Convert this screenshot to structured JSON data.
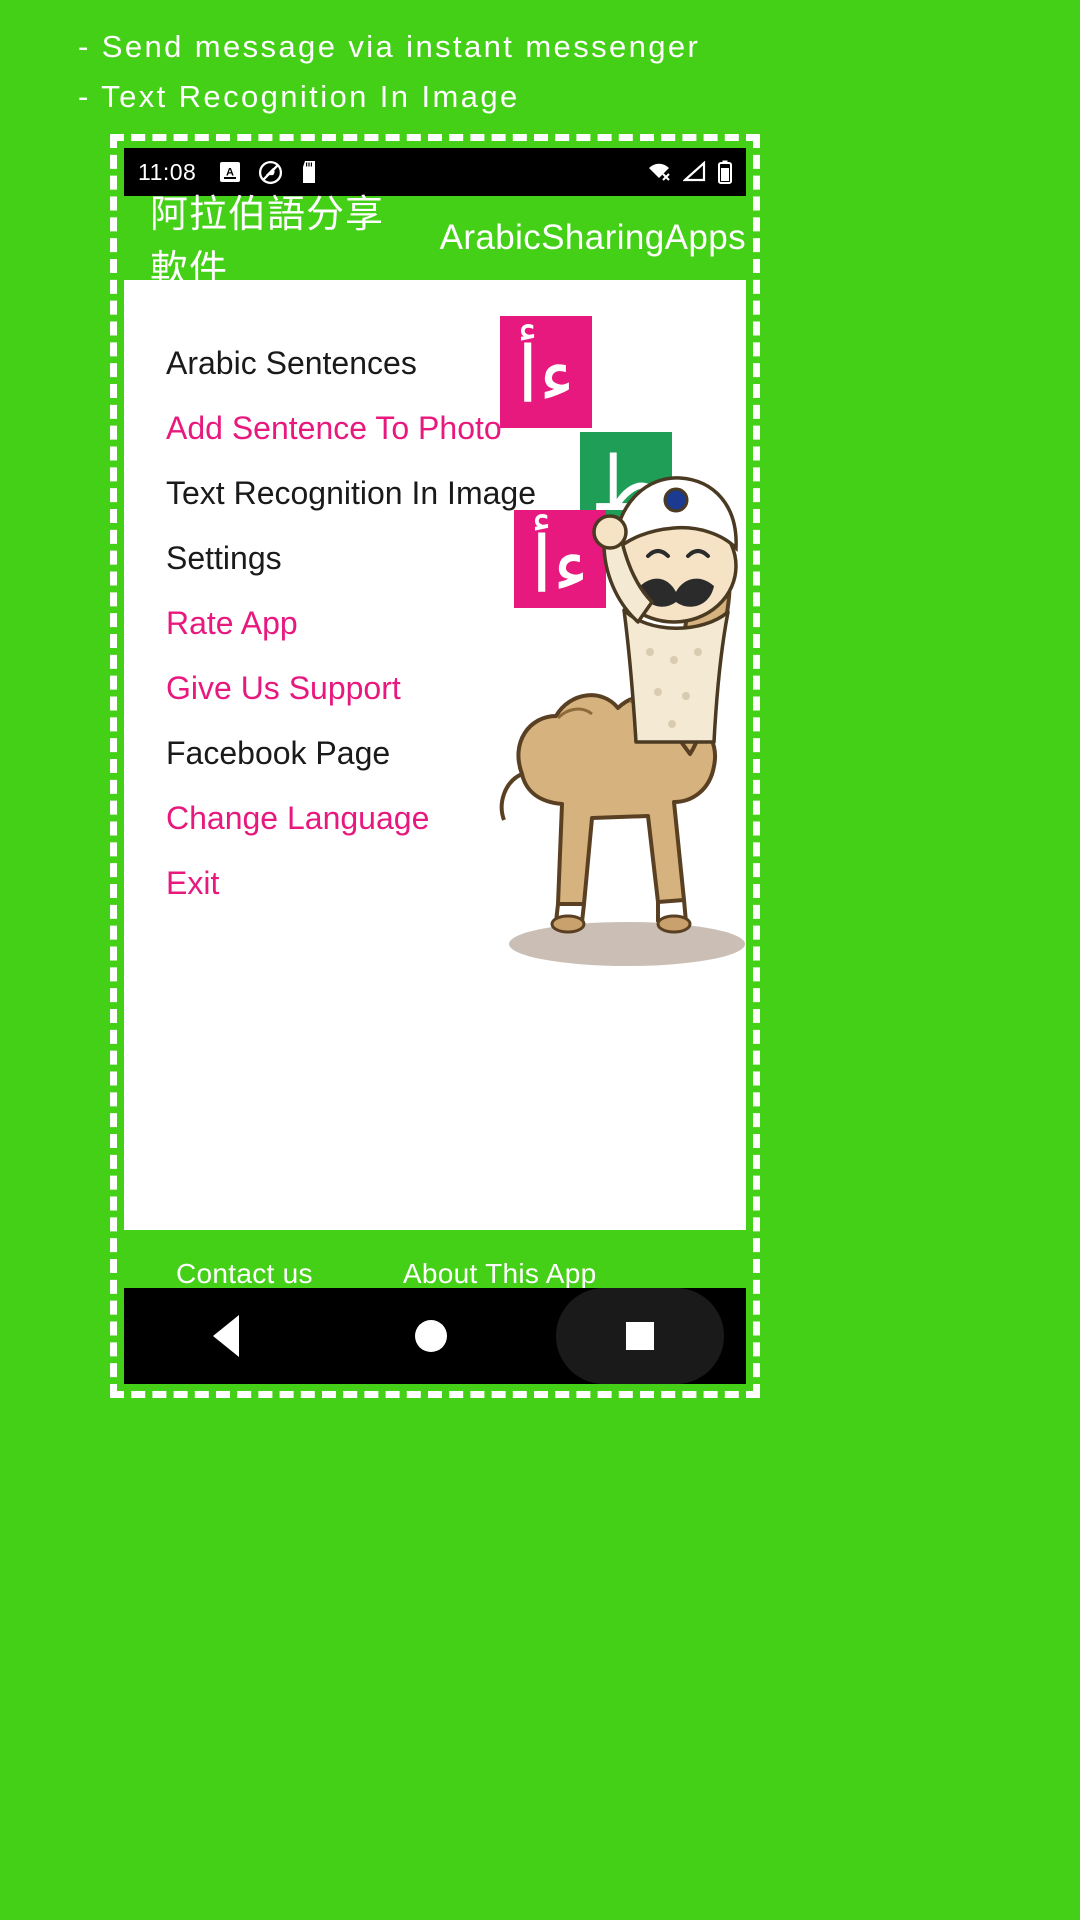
{
  "page": {
    "background_color": "#44D016",
    "accent_pink": "#E8197E",
    "text_white": "#FFFFFF"
  },
  "headings": [
    "- Send message via instant messenger",
    "- Text Recognition In Image"
  ],
  "phone": {
    "status_bar": {
      "time": "11:08",
      "left_icons": [
        "letter-a-badge-icon",
        "do-not-disturb-icon",
        "sd-card-icon"
      ],
      "right_icons": [
        "wifi-off-icon",
        "signal-off-icon",
        "battery-icon"
      ]
    },
    "app_bar": {
      "title_cn": "阿拉伯語分享軟件",
      "title_en": "ArabicSharingApps"
    },
    "menu": {
      "items": [
        {
          "label": "Arabic Sentences",
          "style": "dark"
        },
        {
          "label": "Add Sentence To Photo",
          "style": "pink"
        },
        {
          "label": "Text Recognition In Image",
          "style": "dark"
        },
        {
          "label": "Settings",
          "style": "dark"
        },
        {
          "label": "Rate App",
          "style": "pink"
        },
        {
          "label": "Give Us Support",
          "style": "pink"
        },
        {
          "label": "Facebook Page",
          "style": "dark"
        },
        {
          "label": "Change Language",
          "style": "pink"
        },
        {
          "label": "Exit",
          "style": "pink"
        }
      ]
    },
    "artwork": {
      "tiles": [
        {
          "letter": "ﺀَأ",
          "color": "#E8197E"
        },
        {
          "letter": "ط",
          "color": "#1E9E57"
        },
        {
          "letter": "ﺀَأ",
          "color": "#E8197E"
        }
      ],
      "mascot": "camel-with-arab-character-illustration"
    },
    "footer": {
      "contact_label": "Contact us",
      "about_label": "About This App"
    },
    "nav_bar": {
      "back_label": "back-triangle-icon",
      "home_label": "home-circle-icon",
      "recent_label": "recent-square-icon"
    }
  }
}
